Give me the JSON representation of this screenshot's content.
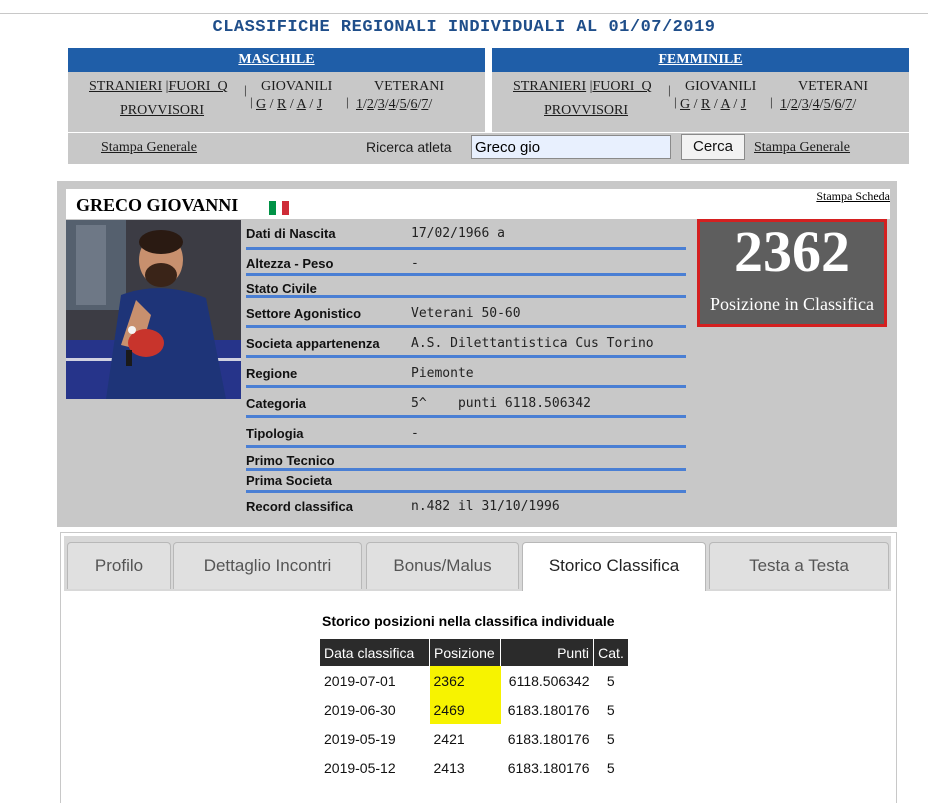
{
  "page": {
    "title": "CLASSIFICHE REGIONALI INDIVIDUALI AL 01/07/2019"
  },
  "nav": {
    "male": {
      "header": "MASCHILE",
      "stranieri": "STRANIERI",
      "fuori_q": "FUORI_Q",
      "provvisori": "PROVVISORI",
      "giovanili": "GIOVANILI",
      "giovanili_links": [
        "G",
        "R",
        "A",
        "J"
      ],
      "veterani": "VETERANI",
      "veterani_links": [
        "1",
        "2",
        "3",
        "4",
        "5",
        "6",
        "7"
      ]
    },
    "female": {
      "header": "FEMMINILE",
      "stranieri": "STRANIERI",
      "fuori_q": "FUORI_Q",
      "provvisori": "PROVVISORI",
      "giovanili": "GIOVANILI",
      "giovanili_links": [
        "G",
        "R",
        "A",
        "J"
      ],
      "veterani": "VETERANI",
      "veterani_links": [
        "1",
        "2",
        "3",
        "4",
        "5",
        "6",
        "7"
      ]
    }
  },
  "search": {
    "print_general_left": "Stampa Generale",
    "label": "Ricerca atleta",
    "value": "Greco gio",
    "button": "Cerca",
    "print_general_right": "Stampa Generale"
  },
  "athlete": {
    "name": "GRECO GIOVANNI",
    "print_card": "Stampa Scheda",
    "flag_colors": [
      "#009246",
      "#ffffff",
      "#ce2b37"
    ],
    "rank": "2362",
    "rank_label": "Posizione in Classifica",
    "fields": [
      {
        "label": "Dati di Nascita",
        "value": "17/02/1966 a"
      },
      {
        "label": "Altezza - Peso",
        "value": "-"
      },
      {
        "label": "Stato Civile",
        "value": ""
      },
      {
        "label": "Settore Agonistico",
        "value": "Veterani 50-60"
      },
      {
        "label": "Societa appartenenza",
        "value": "A.S. Dilettantistica Cus Torino"
      },
      {
        "label": "Regione",
        "value": "Piemonte"
      },
      {
        "label": "Categoria",
        "value": "5^    punti 6118.506342"
      },
      {
        "label": "Tipologia",
        "value": "-"
      },
      {
        "label": "Primo Tecnico",
        "value": ""
      },
      {
        "label": "Prima Societa",
        "value": ""
      },
      {
        "label": "Record classifica",
        "value": "n.482 il 31/10/1996"
      }
    ]
  },
  "tabs": [
    "Profilo",
    "Dettaglio Incontri",
    "Bonus/Malus",
    "Storico Classifica",
    "Testa a Testa"
  ],
  "active_tab": "Storico Classifica",
  "history": {
    "title": "Storico posizioni nella classifica individuale",
    "headers": [
      "Data classifica",
      "Posizione",
      "Punti",
      "Cat."
    ],
    "rows": [
      [
        "2019-07-01",
        "2362",
        "6118.506342",
        "5"
      ],
      [
        "2019-06-30",
        "2469",
        "6183.180176",
        "5"
      ],
      [
        "2019-05-19",
        "2421",
        "6183.180176",
        "5"
      ],
      [
        "2019-05-12",
        "2413",
        "6183.180176",
        "5"
      ]
    ],
    "highlight_color": "#f7f300"
  }
}
